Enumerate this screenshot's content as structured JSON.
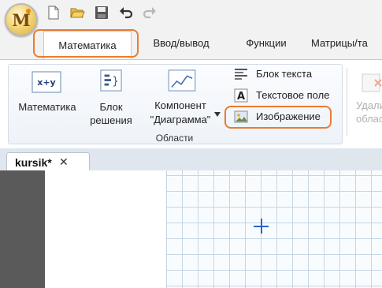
{
  "app": {
    "logo_letter": "M"
  },
  "quick_access": [
    {
      "icon": "new-document-icon"
    },
    {
      "icon": "open-folder-icon"
    },
    {
      "icon": "save-icon"
    },
    {
      "icon": "undo-icon"
    },
    {
      "icon": "redo-icon"
    }
  ],
  "tabs": {
    "math": "Математика",
    "io": "Ввод/вывод",
    "functions": "Функции",
    "matrices": "Матрицы/та"
  },
  "ribbon": {
    "math_button": {
      "label": "Математика",
      "icon": "math-region-icon",
      "icon_text": "x+y"
    },
    "solve_block": {
      "line1": "Блок",
      "line2": "решения",
      "icon": "solve-block-icon"
    },
    "chart_component": {
      "line1": "Компонент",
      "line2": "\"Диаграмма\"",
      "icon": "chart-icon"
    },
    "text_block": {
      "label": "Блок текста",
      "icon": "text-block-icon"
    },
    "text_field": {
      "label": "Текстовое поле",
      "icon": "text-field-icon",
      "icon_text": "A"
    },
    "image": {
      "label": "Изображение",
      "icon": "image-icon"
    },
    "group_caption": "Области",
    "delete_area": {
      "line1": "Удали",
      "line2": "облас"
    }
  },
  "document": {
    "tab_label": "kursik*",
    "close_glyph": "✕"
  },
  "colors": {
    "highlight": "#ec7b2d",
    "cursor": "#2b63c9"
  }
}
